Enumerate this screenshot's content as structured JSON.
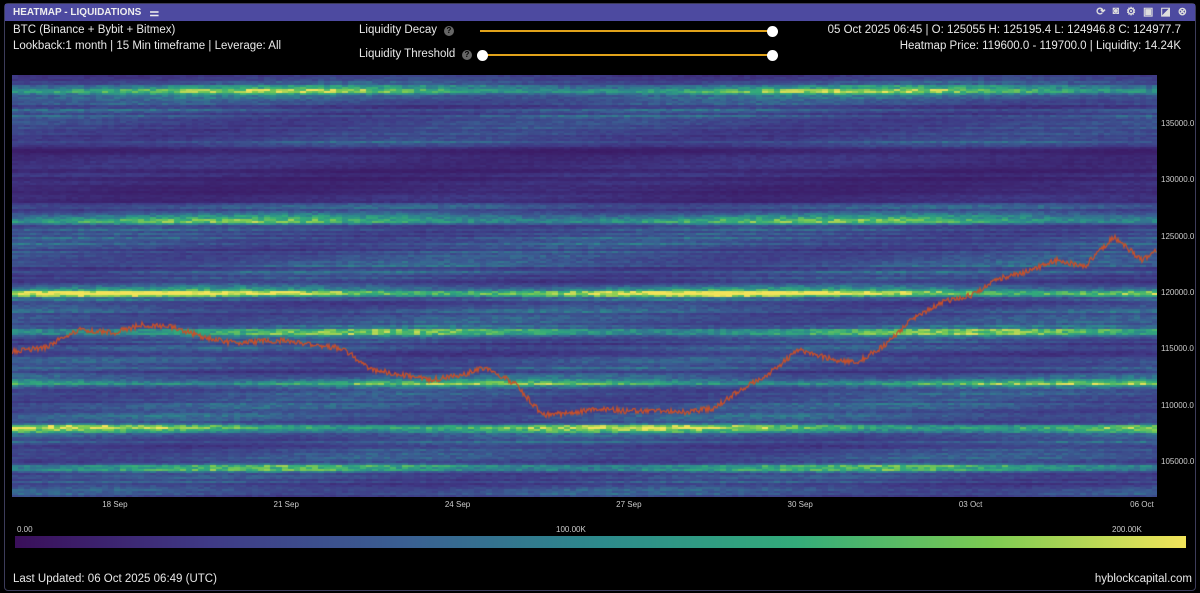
{
  "window": {
    "title": "HEATMAP - LIQUIDATIONS",
    "icons": [
      "settings-sliders-icon",
      "refresh-icon",
      "camera-icon",
      "gear-icon",
      "save-icon",
      "expand-icon",
      "close-icon"
    ]
  },
  "info": {
    "symbol": "BTC (Binance + Bybit + Bitmex)",
    "lookback": "Lookback:1 month | 15 Min timeframe | Leverage: All",
    "ohlc": "05 Oct 2025 06:45 | O: 125055 H: 125195.4 L: 124946.8 C: 124977.7",
    "heatmap_price": "Heatmap Price: 119600.0 - 119700.0 | Liquidity: 14.24K"
  },
  "controls": {
    "decay_label": "Liquidity Decay",
    "decay_value": 1.0,
    "threshold_label": "Liquidity Threshold",
    "threshold_value": [
      0,
      1
    ],
    "help": "?"
  },
  "colorbar": {
    "min": "0.00",
    "mid": "100.00K",
    "max": "200.00K",
    "colors": [
      "#3a0f5a",
      "#3f3a86",
      "#3a5f92",
      "#2d8a8c",
      "#33ab7a",
      "#7ccb52",
      "#f2e45a"
    ]
  },
  "footer": {
    "updated": "Last Updated: 06 Oct 2025 06:49 (UTC)",
    "brand": "hyblockcapital.com"
  },
  "chart_data": {
    "type": "heatmap",
    "title": "Liquidation Heatmap",
    "xlabel": "",
    "ylabel": "",
    "x_ticks": [
      "18 Sep",
      "21 Sep",
      "24 Sep",
      "27 Sep",
      "30 Sep",
      "03 Oct",
      "06 Oct"
    ],
    "y_ticks": [
      "105000.0",
      "110000.0",
      "115000.0",
      "120000.0",
      "125000.0",
      "130000.0",
      "135000.0"
    ],
    "ylim": [
      101900,
      139350
    ],
    "xlim_days": [
      -1.79,
      18.26
    ],
    "price_series": {
      "days": [
        -1.79,
        -1.2,
        -0.6,
        0,
        0.5,
        1,
        1.5,
        2,
        2.5,
        3,
        3.5,
        4,
        4.5,
        5,
        5.5,
        6,
        6.5,
        7,
        7.5,
        8,
        8.5,
        9,
        9.5,
        10,
        10.5,
        11,
        11.5,
        12,
        12.5,
        13,
        13.5,
        14,
        14.5,
        15,
        15.5,
        16,
        16.5,
        17,
        17.5,
        18,
        18.26
      ],
      "price": [
        114800,
        115200,
        116800,
        116500,
        117200,
        117000,
        116200,
        115600,
        115700,
        115800,
        115400,
        115100,
        113200,
        112800,
        112300,
        112600,
        113400,
        112000,
        109200,
        109300,
        109800,
        109500,
        109600,
        109400,
        109800,
        111500,
        113000,
        115000,
        114200,
        113800,
        115400,
        117800,
        119200,
        119800,
        121300,
        121900,
        122900,
        122400,
        125000,
        122900,
        123800
      ]
    },
    "bands": [
      {
        "price": 120000,
        "intensity": 0.9
      },
      {
        "price": 108000,
        "intensity": 0.75
      },
      {
        "price": 116500,
        "intensity": 0.6
      },
      {
        "price": 126500,
        "intensity": 0.55
      },
      {
        "price": 138000,
        "intensity": 0.6
      },
      {
        "price": 112000,
        "intensity": 0.55
      },
      {
        "price": 104500,
        "intensity": 0.5
      }
    ]
  }
}
